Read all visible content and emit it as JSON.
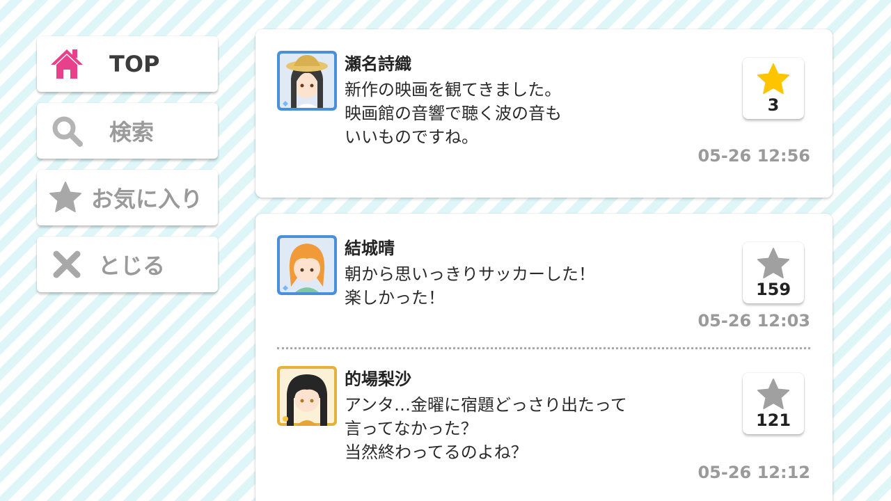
{
  "sidebar": {
    "items": [
      {
        "label": "TOP",
        "icon": "home-icon",
        "active": true
      },
      {
        "label": "検索",
        "icon": "search-icon",
        "active": false
      },
      {
        "label": "お気に入り",
        "icon": "star-icon",
        "active": false
      },
      {
        "label": "とじる",
        "icon": "close-icon",
        "active": false
      }
    ]
  },
  "posts": [
    {
      "author": "瀬名詩織",
      "message_lines": [
        "新作の映画を観てきました。",
        "映画館の音響で聴く波の音も",
        "いいものですね。"
      ],
      "likes": "3",
      "liked": true,
      "timestamp": "05-26 12:56",
      "avatar_frame": "#4a8fd9"
    },
    {
      "author": "結城晴",
      "message_lines": [
        "朝から思いっきりサッカーした！",
        "楽しかった！"
      ],
      "likes": "159",
      "liked": false,
      "timestamp": "05-26 12:03",
      "avatar_frame": "#4a8fd9"
    },
    {
      "author": "的場梨沙",
      "message_lines": [
        "アンタ…金曜に宿題どっさり出たって",
        "言ってなかった？",
        "当然終わってるのよね？"
      ],
      "likes": "121",
      "liked": false,
      "timestamp": "05-26 12:12",
      "avatar_frame": "#e3b23c"
    }
  ],
  "colors": {
    "accent_pink": "#e8408a",
    "star_active": "#ffc400",
    "star_inactive": "#a0a0a0",
    "inactive_text": "#9a9a9a",
    "stripe": "#dff6f8"
  }
}
